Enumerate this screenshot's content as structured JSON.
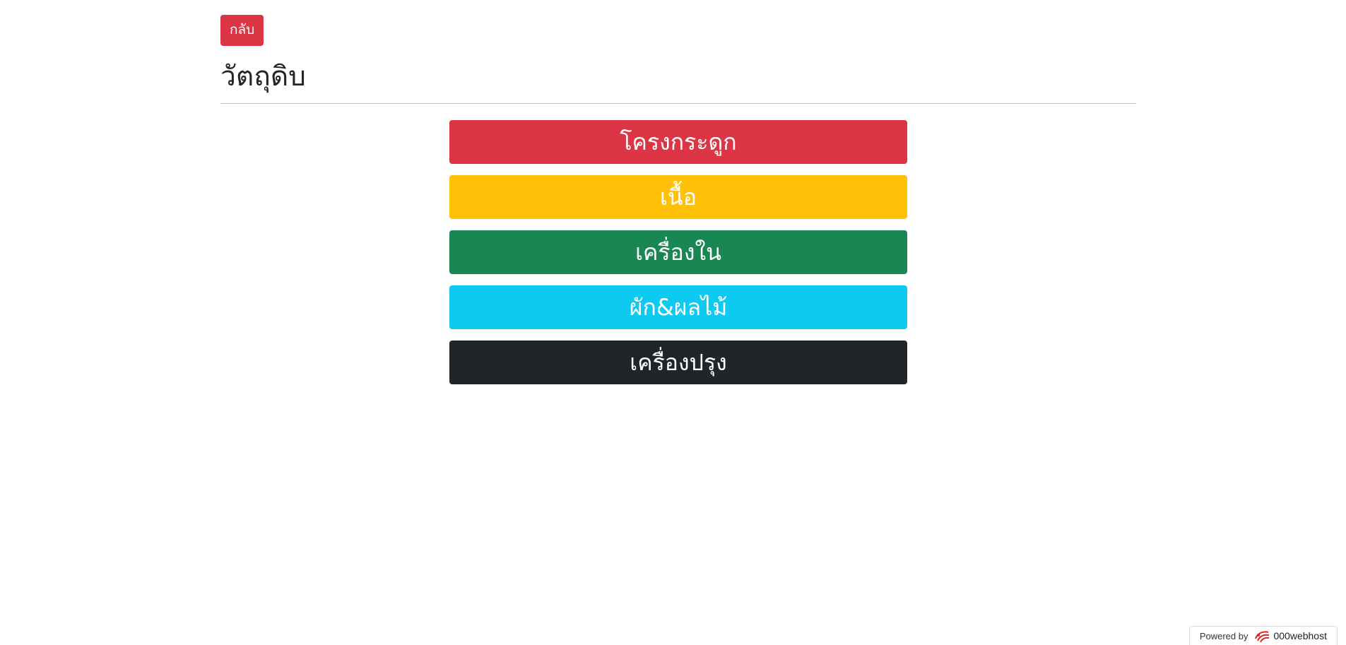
{
  "header": {
    "back_label": "กลับ",
    "title": "วัตถุดิบ"
  },
  "menu": {
    "items": [
      {
        "label": "โครงกระดูก",
        "color": "#dc3545"
      },
      {
        "label": "เนื้อ",
        "color": "#ffc107"
      },
      {
        "label": "เครื่องใน",
        "color": "#198754"
      },
      {
        "label": "ผัก&ผลไม้",
        "color": "#0dcaf0"
      },
      {
        "label": "เครื่องปรุง",
        "color": "#212529"
      }
    ]
  },
  "footer": {
    "powered_by": "Powered by",
    "brand": "000webhost",
    "logo_icon": "000webhost-logo-icon"
  }
}
